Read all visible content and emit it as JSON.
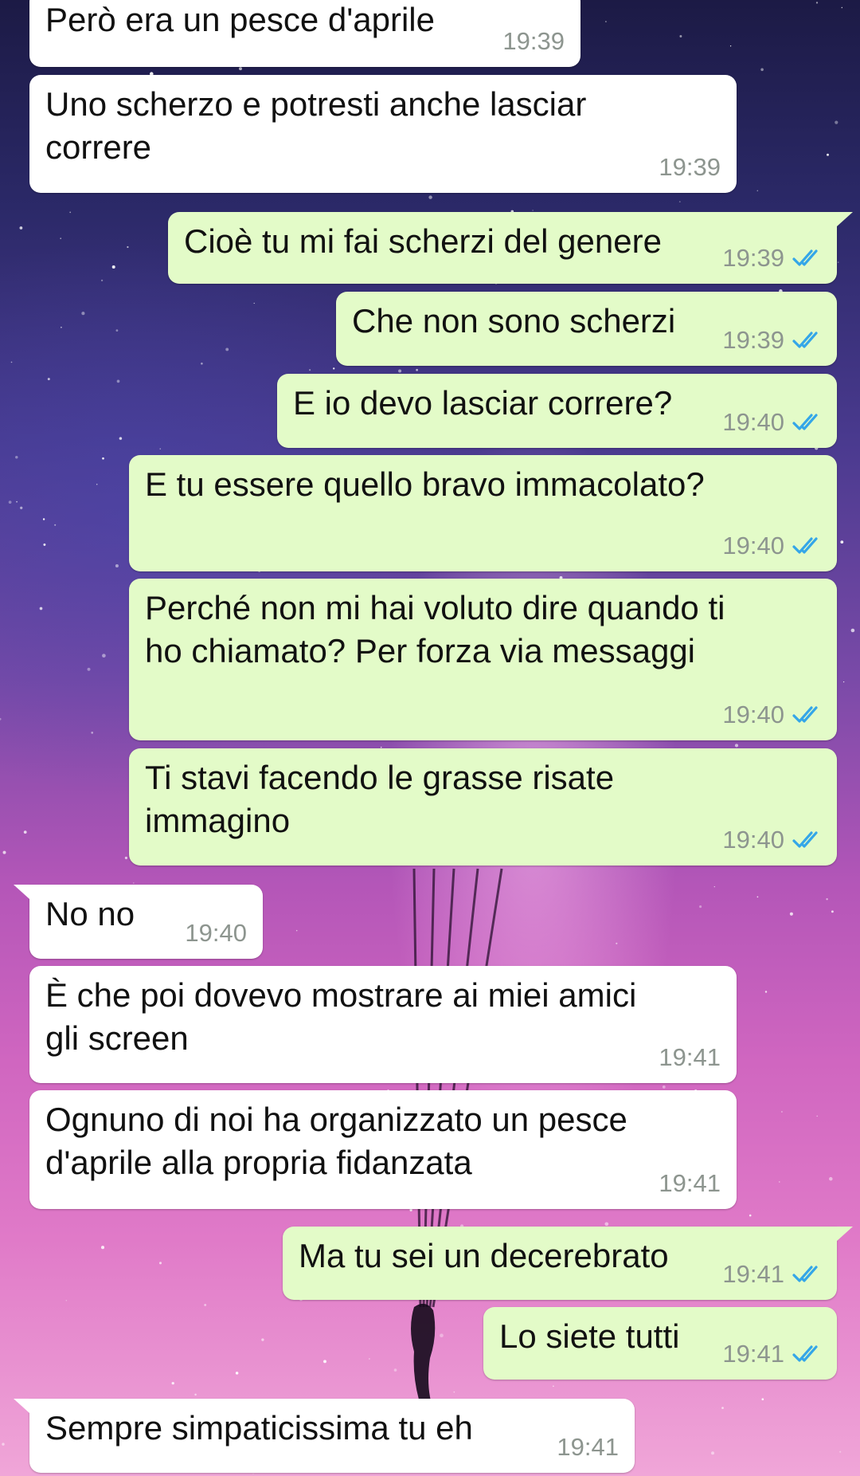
{
  "colors": {
    "incoming_bubble": "#ffffff",
    "outgoing_bubble": "#e3fbc8",
    "read_ticks": "#34a6e8",
    "timestamp": "#8d958f"
  },
  "read_icon": "double-check-icon",
  "messages": [
    {
      "dir": "in",
      "text": "Però era un pesce d'aprile",
      "time": "19:39"
    },
    {
      "dir": "in",
      "text": "Uno scherzo e potresti anche lasciar\ncorrere",
      "time": "19:39"
    },
    {
      "dir": "out",
      "text": "Cioè tu mi fai scherzi del genere",
      "time": "19:39",
      "read": true
    },
    {
      "dir": "out",
      "text": "Che non sono scherzi",
      "time": "19:39",
      "read": true
    },
    {
      "dir": "out",
      "text": "E io devo lasciar correre?",
      "time": "19:40",
      "read": true
    },
    {
      "dir": "out",
      "text": "E tu essere quello bravo immacolato?",
      "time": "19:40",
      "read": true
    },
    {
      "dir": "out",
      "text": "Perché non mi hai voluto dire quando ti\nho chiamato? Per forza via messaggi",
      "time": "19:40",
      "read": true
    },
    {
      "dir": "out",
      "text": "Ti stavi facendo le grasse risate\nimmagino",
      "time": "19:40",
      "read": true
    },
    {
      "dir": "in",
      "text": "No no",
      "time": "19:40"
    },
    {
      "dir": "in",
      "text": "È che poi dovevo mostrare ai miei amici\ngli screen",
      "time": "19:41"
    },
    {
      "dir": "in",
      "text": "Ognuno di noi ha organizzato un pesce\nd'aprile alla propria fidanzata",
      "time": "19:41"
    },
    {
      "dir": "out",
      "text": "Ma tu sei un decerebrato",
      "time": "19:41",
      "read": true
    },
    {
      "dir": "out",
      "text": "Lo siete tutti",
      "time": "19:41",
      "read": true
    },
    {
      "dir": "in",
      "text": "Sempre simpaticissima tu eh",
      "time": "19:41"
    }
  ]
}
